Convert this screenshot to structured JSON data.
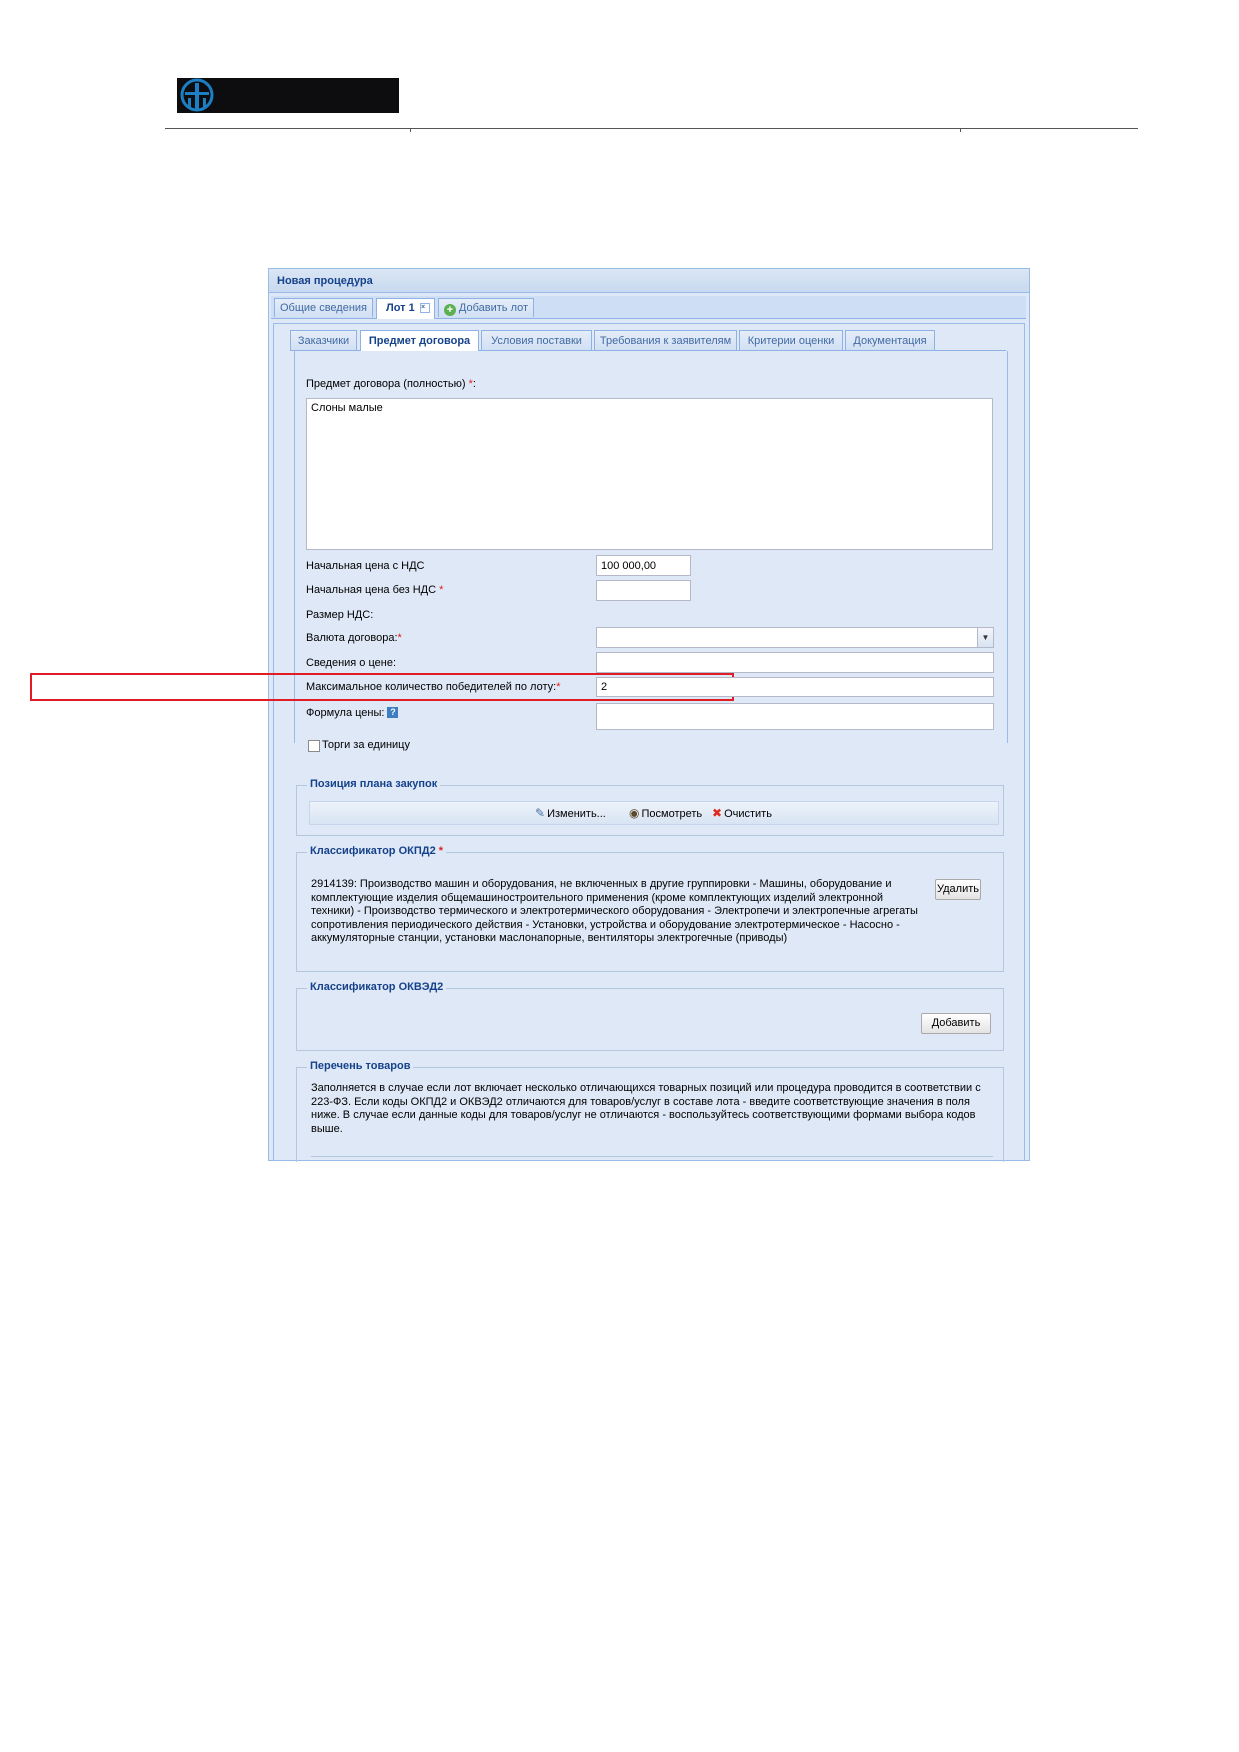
{
  "window": {
    "title": "Новая процедура"
  },
  "top_tabs": [
    {
      "label": "Общие сведения"
    },
    {
      "label": "Лот 1"
    },
    {
      "label": "Добавить лот"
    }
  ],
  "sub_tabs": [
    {
      "label": "Заказчики"
    },
    {
      "label": "Предмет договора"
    },
    {
      "label": "Условия поставки"
    },
    {
      "label": "Требования к заявителям"
    },
    {
      "label": "Критерии оценки"
    },
    {
      "label": "Документация"
    }
  ],
  "form": {
    "subject_label": "Предмет договора (полностью)",
    "subject_value": "Слоны малые",
    "price_vat_label": "Начальная цена с НДС",
    "price_vat_value": "100 000,00",
    "price_novat_label": "Начальная цена без НДС",
    "price_novat_value": "",
    "vat_size_label": "Размер НДС:",
    "currency_label": "Валюта договора:",
    "currency_value": "",
    "price_info_label": "Сведения о цене:",
    "price_info_value": "",
    "max_winners_label": "Максимальное количество победителей по лоту:",
    "max_winners_value": "2",
    "formula_label": "Формула цены:",
    "formula_value": "",
    "per_unit_label": "Торги за единицу",
    "required_mark": "*",
    "help_mark": "?"
  },
  "plan_position": {
    "legend": "Позиция плана закупок",
    "edit_label": "Изменить...",
    "view_label": "Посмотреть",
    "clear_label": "Очистить"
  },
  "okpd2": {
    "legend": "Классификатор ОКПД2",
    "text": "2914139: Производство машин и оборудования, не включенных в другие группировки - Машины, оборудование и комплектующие изделия общемашиностроительного применения (кроме комплектующих изделий электронной техники) - Производство термического и электротермического оборудования - Электропечи и электропечные агрегаты сопротивления периодического действия - Установки, устройства и оборудование электротермическое - Насосно - аккумуляторные станции, установки маслонапорные, вентиляторы электрогечные (приводы)",
    "delete_label": "Удалить"
  },
  "okved2": {
    "legend": "Классификатор ОКВЭД2",
    "add_label": "Добавить"
  },
  "goods_list": {
    "legend": "Перечень товаров",
    "text": "Заполняется в случае если лот включает несколько отличающихся товарных позиций или процедура проводится в соответствии с 223-ФЗ. Если коды ОКПД2 и ОКВЭД2 отличаются для товаров/услуг в составе лота - введите соответствующие значения в поля ниже. В случае если данные коды для товаров/услуг не отличаются - воспользуйтесь соответствующими формами выбора кодов выше."
  },
  "colors": {
    "highlight": "#e01d24",
    "title_text": "#15428b",
    "panel_bg": "#dfe8f6",
    "border": "#99bbe8"
  }
}
